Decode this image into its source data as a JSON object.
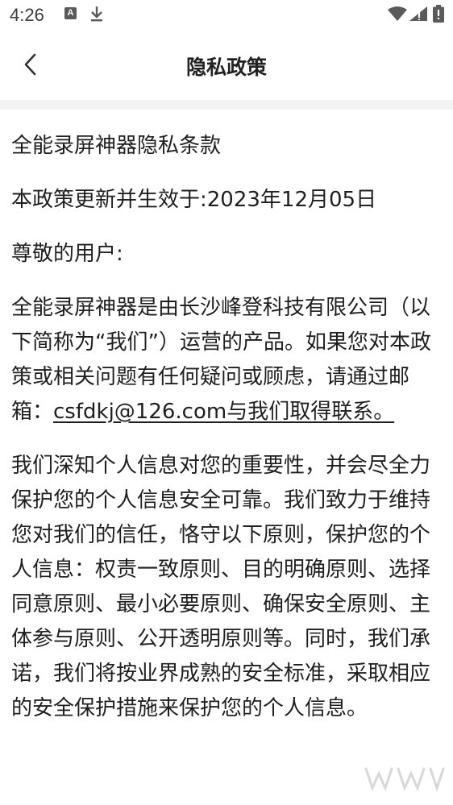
{
  "status_bar": {
    "time": "4:26",
    "notification_letter": "A",
    "icons": [
      "a-notification-icon",
      "download-icon",
      "wifi-icon",
      "signal-icon",
      "battery-icon"
    ]
  },
  "header": {
    "title": "隐私政策",
    "back_icon": "chevron-left-icon"
  },
  "content": {
    "heading": "全能录屏神器隐私条款",
    "effective_date": "本政策更新并生效于:2023年12月05日",
    "greeting": "尊敬的用户:",
    "intro_text": "全能录屏神器是由长沙峰登科技有限公司（以下简称为“我们”）运营的产品。如果您对本政策或相关问题有任何疑问或顾虑，请通过邮箱：",
    "contact_link": "csfdkj@126.com与我们取得联系。",
    "principles": "我们深知个人信息对您的重要性，并会尽全力保护您的个人信息安全可靠。我们致力于维持您对我们的信任，恪守以下原则，保护您的个人信息：权责一致原则、目的明确原则、选择同意原则、最小必要原则、确保安全原则、主体参与原则、公开透明原则等。同时，我们承诺，我们将按业界成熟的安全标准，采取相应的安全保护措施来保护您的个人信息。"
  },
  "colors": {
    "text": "#1f1f1f",
    "divider_band": "#f3f3f3",
    "status_icons": "#5a5a5a"
  }
}
